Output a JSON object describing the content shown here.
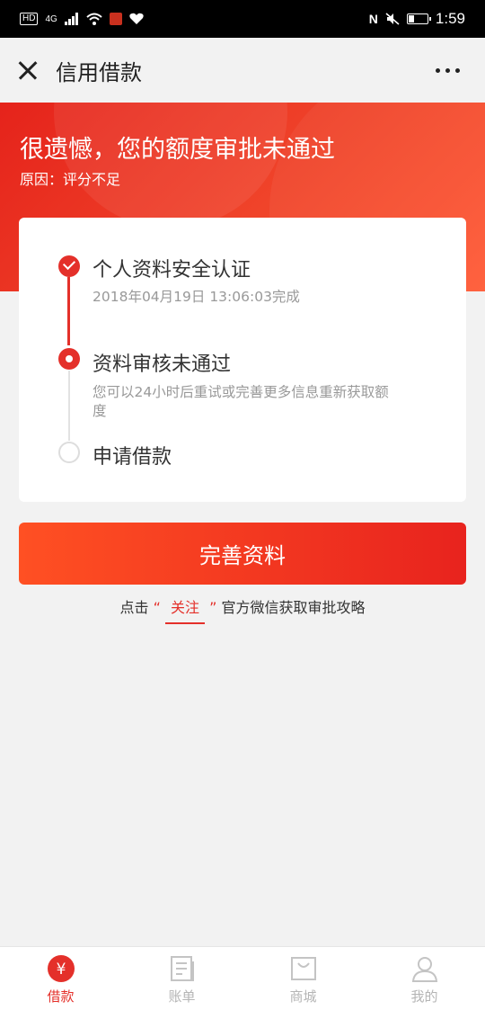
{
  "status_bar": {
    "left_badge": "HD",
    "network": "4G",
    "time": "1:59"
  },
  "nav": {
    "title": "信用借款",
    "close_icon": "close-icon",
    "more_icon": "more-icon"
  },
  "banner": {
    "title": "很遗憾，您的额度审批未通过",
    "reason": "原因：评分不足"
  },
  "steps": [
    {
      "title": "个人资料安全认证",
      "desc": "2018年04月19日 13:06:03完成",
      "state": "done"
    },
    {
      "title": "资料审核未通过",
      "desc": "您可以24小时后重试或完善更多信息重新获取额度",
      "state": "current"
    },
    {
      "title": "申请借款",
      "desc": "",
      "state": "pending"
    }
  ],
  "primary_button": {
    "label": "完善资料"
  },
  "tip": {
    "prefix": "点击",
    "quote_open": "“",
    "follow": "关注",
    "quote_close": "”",
    "suffix": "官方微信获取审批攻略"
  },
  "tabs": [
    {
      "label": "借款",
      "icon": "yuan-icon",
      "active": true
    },
    {
      "label": "账单",
      "icon": "bill-icon",
      "active": false
    },
    {
      "label": "商城",
      "icon": "shop-icon",
      "active": false
    },
    {
      "label": "我的",
      "icon": "user-icon",
      "active": false
    }
  ],
  "colors": {
    "accent": "#e4302a",
    "banner_start": "#e5231b",
    "banner_end": "#ff5a35",
    "inactive": "#b5b5b5"
  }
}
